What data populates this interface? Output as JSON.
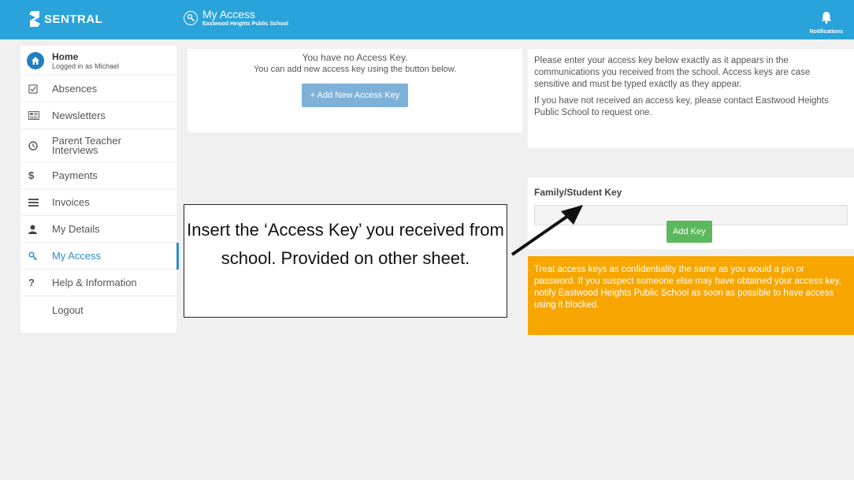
{
  "topbar": {
    "brand": "SENTRAL",
    "page_title": "My Access",
    "page_subtitle": "Eastwood Heights Public School",
    "notifications_label": "Notifications",
    "bg_color": "#29a3d9"
  },
  "sidebar": {
    "home": {
      "label": "Home",
      "sub": "Logged in as Michael",
      "icon": "home-icon"
    },
    "items": [
      {
        "label": "Absences",
        "icon": "checkbox-icon"
      },
      {
        "label": "Newsletters",
        "icon": "newspaper-icon"
      },
      {
        "label": "Parent Teacher Interviews",
        "icon": "clock-icon"
      },
      {
        "label": "Payments",
        "icon": "dollar-icon"
      },
      {
        "label": "Invoices",
        "icon": "list-icon"
      },
      {
        "label": "My Details",
        "icon": "user-icon"
      },
      {
        "label": "My Access",
        "icon": "key-icon",
        "active": true
      },
      {
        "label": "Help & Information",
        "icon": "question-icon"
      },
      {
        "label": "Logout"
      }
    ]
  },
  "main": {
    "no_key_msg": "You have no Access Key.",
    "add_msg": "You can add new access key using the button below.",
    "add_button": "+ Add New Access Key"
  },
  "info": {
    "para1": "Please enter your access key below exactly as it appears in the communications you received from the school. Access keys are case sensitive and must be typed exactly as they appear.",
    "para2": "If you have not received an access key, please contact Eastwood Heights Public School to request one."
  },
  "key_form": {
    "label": "Family/Student Key",
    "input_value": "",
    "button": "Add Key"
  },
  "warning": {
    "text": "Treat access keys as confidentiality the same as you would a pin or password. If you suspect someone else may have obtained your access key, notify Eastwood Heights Public School as soon as possible to have access using it blocked."
  },
  "callout": {
    "text": "Insert the ‘Access Key’ you received from school. Provided on other sheet."
  }
}
